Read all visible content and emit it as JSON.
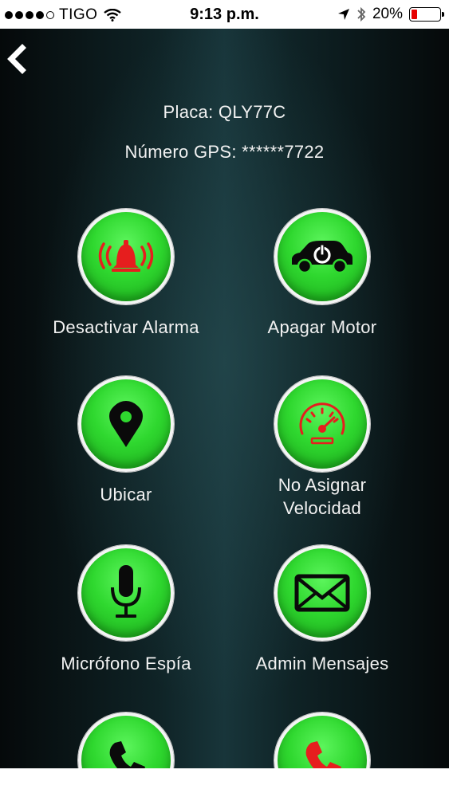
{
  "status_bar": {
    "carrier": "TIGO",
    "time": "9:13 p.m.",
    "battery": "20%",
    "battery_level": 0.2,
    "battery_color": "#e60000",
    "icons": [
      "signal-dots-icon",
      "wifi-icon",
      "location-arrow-icon",
      "bluetooth-icon",
      "battery-icon"
    ]
  },
  "header": {
    "back_icon": "chevron-left-icon",
    "plate": "Placa: QLY77C",
    "gps_number": "Número GPS: ******7722"
  },
  "actions": [
    {
      "id": "desactivar-alarma",
      "label": "Desactivar Alarma",
      "icon": "alarm-bell-icon"
    },
    {
      "id": "apagar-motor",
      "label": "Apagar Motor",
      "icon": "car-power-icon"
    },
    {
      "id": "ubicar",
      "label": "Ubicar",
      "icon": "map-pin-icon"
    },
    {
      "id": "asignar-velocidad",
      "label_line1": "No Asignar",
      "label_line2": "Velocidad",
      "icon": "speedometer-icon"
    },
    {
      "id": "microfono-espia",
      "label": "Micrófono Espía",
      "icon": "microphone-icon"
    },
    {
      "id": "admin-mensajes",
      "label": "Admin Mensajes",
      "icon": "envelope-icon"
    },
    {
      "id": "llamar",
      "icon": "phone-icon"
    },
    {
      "id": "colgar",
      "icon": "phone-red-icon"
    }
  ],
  "colors": {
    "button_green": "#2fd82f",
    "alert_red": "#e61e1e",
    "text": "#f2f2f2"
  }
}
